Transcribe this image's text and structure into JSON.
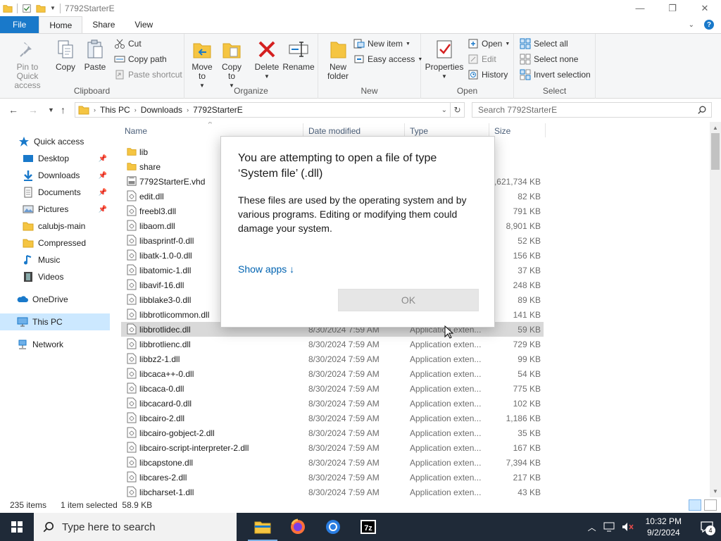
{
  "window": {
    "title": "7792StarterE",
    "minimize_glyph": "—",
    "maximize_glyph": "❐",
    "close_glyph": "✕"
  },
  "ribbon_tabs": [
    "File",
    "Home",
    "Share",
    "View"
  ],
  "ribbon": {
    "clipboard": {
      "label": "Clipboard",
      "pin": "Pin to Quick access",
      "copy": "Copy",
      "paste": "Paste",
      "cut": "Cut",
      "copy_path": "Copy path",
      "paste_shortcut": "Paste shortcut"
    },
    "organize": {
      "label": "Organize",
      "move_to": "Move to",
      "copy_to": "Copy to",
      "delete": "Delete",
      "rename": "Rename"
    },
    "new": {
      "label": "New",
      "new_folder": "New folder",
      "new_item": "New item",
      "easy_access": "Easy access"
    },
    "open": {
      "label": "Open",
      "properties": "Properties",
      "open": "Open",
      "edit": "Edit",
      "history": "History"
    },
    "select": {
      "label": "Select",
      "select_all": "Select all",
      "select_none": "Select none",
      "invert_selection": "Invert selection"
    }
  },
  "address": {
    "segments": [
      "This PC",
      "Downloads",
      "7792StarterE"
    ],
    "search_placeholder": "Search 7792StarterE"
  },
  "nav_pane": {
    "quick_access": "Quick access",
    "items": [
      "Desktop",
      "Downloads",
      "Documents",
      "Pictures",
      "calubjs-main",
      "Compressed",
      "Music",
      "Videos"
    ],
    "onedrive": "OneDrive",
    "this_pc": "This PC",
    "network": "Network"
  },
  "columns": {
    "name": "Name",
    "date": "Date modified",
    "type": "Type",
    "size": "Size"
  },
  "files": [
    {
      "name": "lib",
      "date": "",
      "type": "",
      "size": "",
      "kind": "folder"
    },
    {
      "name": "share",
      "date": "",
      "type": "",
      "size": "",
      "kind": "folder"
    },
    {
      "name": "7792StarterE.vhd",
      "date": "",
      "type": "",
      "size": "3,621,734 KB",
      "kind": "vhd"
    },
    {
      "name": "edit.dll",
      "date": "",
      "type": "",
      "size": "82 KB",
      "kind": "dll"
    },
    {
      "name": "freebl3.dll",
      "date": "",
      "type": "",
      "size": "791 KB",
      "kind": "dll"
    },
    {
      "name": "libaom.dll",
      "date": "",
      "type": "",
      "size": "8,901 KB",
      "kind": "dll"
    },
    {
      "name": "libasprintf-0.dll",
      "date": "",
      "type": "",
      "size": "52 KB",
      "kind": "dll"
    },
    {
      "name": "libatk-1.0-0.dll",
      "date": "",
      "type": "",
      "size": "156 KB",
      "kind": "dll"
    },
    {
      "name": "libatomic-1.dll",
      "date": "",
      "type": "",
      "size": "37 KB",
      "kind": "dll"
    },
    {
      "name": "libavif-16.dll",
      "date": "",
      "type": "",
      "size": "248 KB",
      "kind": "dll"
    },
    {
      "name": "libblake3-0.dll",
      "date": "",
      "type": "",
      "size": "89 KB",
      "kind": "dll"
    },
    {
      "name": "libbrotlicommon.dll",
      "date": "",
      "type": "",
      "size": "141 KB",
      "kind": "dll"
    },
    {
      "name": "libbrotlidec.dll",
      "date": "8/30/2024 7:59 AM",
      "type": "Application exten...",
      "size": "59 KB",
      "kind": "dll",
      "selected": true
    },
    {
      "name": "libbrotlienc.dll",
      "date": "8/30/2024 7:59 AM",
      "type": "Application exten...",
      "size": "729 KB",
      "kind": "dll"
    },
    {
      "name": "libbz2-1.dll",
      "date": "8/30/2024 7:59 AM",
      "type": "Application exten...",
      "size": "99 KB",
      "kind": "dll"
    },
    {
      "name": "libcaca++-0.dll",
      "date": "8/30/2024 7:59 AM",
      "type": "Application exten...",
      "size": "54 KB",
      "kind": "dll"
    },
    {
      "name": "libcaca-0.dll",
      "date": "8/30/2024 7:59 AM",
      "type": "Application exten...",
      "size": "775 KB",
      "kind": "dll"
    },
    {
      "name": "libcacard-0.dll",
      "date": "8/30/2024 7:59 AM",
      "type": "Application exten...",
      "size": "102 KB",
      "kind": "dll"
    },
    {
      "name": "libcairo-2.dll",
      "date": "8/30/2024 7:59 AM",
      "type": "Application exten...",
      "size": "1,186 KB",
      "kind": "dll"
    },
    {
      "name": "libcairo-gobject-2.dll",
      "date": "8/30/2024 7:59 AM",
      "type": "Application exten...",
      "size": "35 KB",
      "kind": "dll"
    },
    {
      "name": "libcairo-script-interpreter-2.dll",
      "date": "8/30/2024 7:59 AM",
      "type": "Application exten...",
      "size": "167 KB",
      "kind": "dll"
    },
    {
      "name": "libcapstone.dll",
      "date": "8/30/2024 7:59 AM",
      "type": "Application exten...",
      "size": "7,394 KB",
      "kind": "dll"
    },
    {
      "name": "libcares-2.dll",
      "date": "8/30/2024 7:59 AM",
      "type": "Application exten...",
      "size": "217 KB",
      "kind": "dll"
    },
    {
      "name": "libcharset-1.dll",
      "date": "8/30/2024 7:59 AM",
      "type": "Application exten...",
      "size": "43 KB",
      "kind": "dll"
    }
  ],
  "status": {
    "items": "235 items",
    "selected": "1 item selected  58.9 KB"
  },
  "dialog": {
    "title": "You are attempting to open a file of type ‘System file’ (.dll)",
    "body": "These files are used by the operating system and by various programs. Editing or modifying them could damage your system.",
    "show_apps": "Show apps ↓",
    "ok": "OK"
  },
  "taskbar": {
    "search_placeholder": "Type here to search",
    "time": "10:32 PM",
    "date": "9/2/2024",
    "notification_count": "4"
  },
  "colors": {
    "accent": "#1979ca",
    "selection": "#cce8ff",
    "taskbar": "#1f2a38",
    "link": "#0063b1"
  }
}
